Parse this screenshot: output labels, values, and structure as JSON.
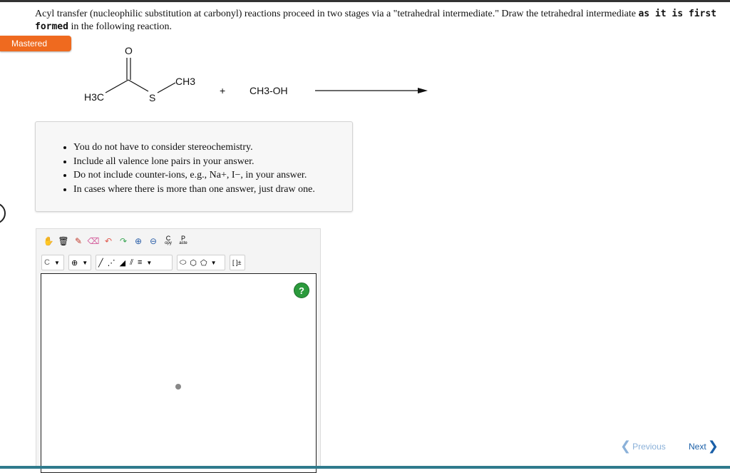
{
  "question": {
    "text_part1": "Acyl transfer (nucleophilic substitution at carbonyl) reactions proceed in two stages via a \"tetrahedral intermediate.\" Draw the tetrahedral intermediate ",
    "text_bold": "as it is first formed",
    "text_part2": " in the following reaction."
  },
  "status_badge": "Mastered",
  "reaction": {
    "oxygen": "O",
    "methyl_left": "H3C",
    "sulfur": "S",
    "methyl_right": "CH3",
    "plus": "+",
    "reagent": "CH3-OH"
  },
  "notes": [
    "You do not have to consider stereochemistry.",
    "Include all valence lone pairs in your answer.",
    "Do not include counter-ions, e.g., Na+, I−, in your answer.",
    "In cases where there is more than one answer, just draw one."
  ],
  "toolbar": {
    "copy_label": "C",
    "copy_small": "opy",
    "paste_label": "P",
    "paste_small": "aste",
    "element_label": "C",
    "charge_label": "⊕",
    "bracket_label": "[ ]±"
  },
  "help_label": "?",
  "nav": {
    "previous": "Previous",
    "next": "Next"
  },
  "colors": {
    "mastered_badge": "#ef6a1f",
    "help_button": "#2b9a3c",
    "next_link": "#1a5fa8",
    "previous_link": "#8bb1d9"
  }
}
